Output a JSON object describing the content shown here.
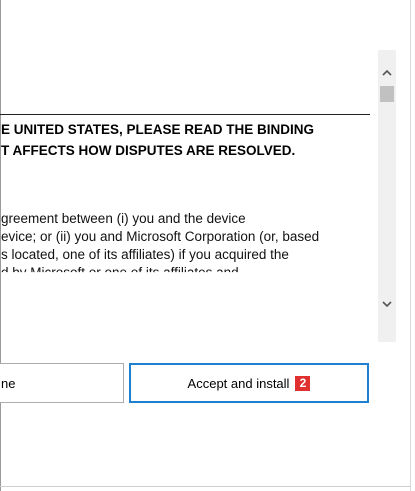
{
  "license": {
    "heading_lines": [
      "E UNITED STATES, PLEASE READ THE BINDING",
      "T AFFECTS HOW DISPUTES ARE RESOLVED."
    ],
    "body_lines": [
      "greement between (i) you and the device",
      "evice; or (ii) you and Microsoft Corporation (or, based",
      "s located, one of its affiliates) if you acquired the",
      "d by Microsoft or one of its affiliates and"
    ]
  },
  "buttons": {
    "decline_label": "ne",
    "accept_label": "Accept and install",
    "accept_badge": "2"
  },
  "scrollbar": {
    "up_icon": "chevron-up-icon",
    "down_icon": "chevron-down-icon"
  },
  "colors": {
    "accent": "#1f7fd0",
    "badge": "#e03030"
  }
}
